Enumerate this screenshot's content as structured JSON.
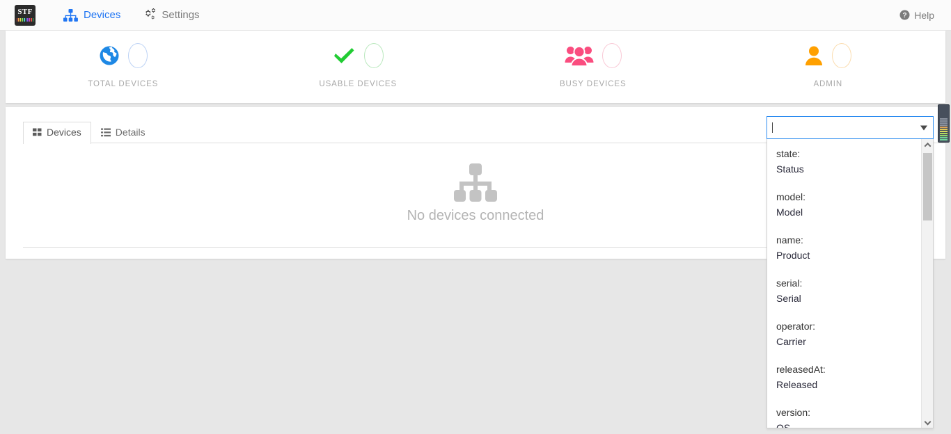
{
  "nav": {
    "logo_text": "STF",
    "logo_bar_colors": [
      "#e64b4b",
      "#e6a14b",
      "#e6e04b",
      "#7fd44b",
      "#4bd4c4",
      "#4b8fe6",
      "#8f4be6",
      "#e64bb2",
      "#e64b4b",
      "#4bd46a"
    ],
    "items": [
      {
        "label": "Devices",
        "icon": "sitemap-icon",
        "active": true
      },
      {
        "label": "Settings",
        "icon": "gears-icon",
        "active": false
      }
    ],
    "help": {
      "label": "Help",
      "icon": "question-circle-icon"
    }
  },
  "stats": {
    "items": [
      {
        "label": "TOTAL DEVICES",
        "icon": "globe-icon",
        "value": "",
        "color": "#1e88e5",
        "badge_border": "#bcd2f5"
      },
      {
        "label": "USABLE DEVICES",
        "icon": "check-icon",
        "value": "",
        "color": "#21cc33",
        "badge_border": "#b9e8bd"
      },
      {
        "label": "BUSY DEVICES",
        "icon": "users-icon",
        "value": "",
        "color": "#fa4d7f",
        "badge_border": "#f9c8d5"
      },
      {
        "label": "ADMIN",
        "icon": "user-icon",
        "value": "",
        "color": "#ffa000",
        "badge_border": "#fbdcae"
      }
    ]
  },
  "content": {
    "tabs": [
      {
        "label": "Devices",
        "icon": "grid-icon",
        "active": true
      },
      {
        "label": "Details",
        "icon": "list-icon",
        "active": false
      }
    ],
    "empty_state": {
      "icon": "sitemap-icon",
      "text": "No devices connected"
    }
  },
  "search": {
    "value": "",
    "placeholder": "",
    "arrow_icon": "caret-down-icon",
    "dropdown": {
      "scroll_up_icon": "chevron-up-icon",
      "scroll_down_icon": "chevron-down-icon",
      "options": [
        {
          "key": "state:",
          "label": "Status"
        },
        {
          "key": "model:",
          "label": "Model"
        },
        {
          "key": "name:",
          "label": "Product"
        },
        {
          "key": "serial:",
          "label": "Serial"
        },
        {
          "key": "operator:",
          "label": "Carrier"
        },
        {
          "key": "releasedAt:",
          "label": "Released"
        },
        {
          "key": "version:",
          "label": "OS"
        }
      ]
    }
  },
  "level_meter": {
    "name": "level-meter-widget",
    "bar_colors": [
      "#6fd49a",
      "#6fd49a",
      "#8fd86f",
      "#b6dd5f",
      "#d6dd5f",
      "#e0c75a",
      "#e0a55a",
      "#8c93a0",
      "#8c93a0",
      "#8c93a0",
      "#8c93a0"
    ]
  },
  "theme": {
    "accent": "#2176f3",
    "focus_border": "#2d8cf0",
    "page_bg": "#e7e7e7",
    "panel_bg": "#ffffff",
    "muted_text": "#a8a8a8"
  }
}
